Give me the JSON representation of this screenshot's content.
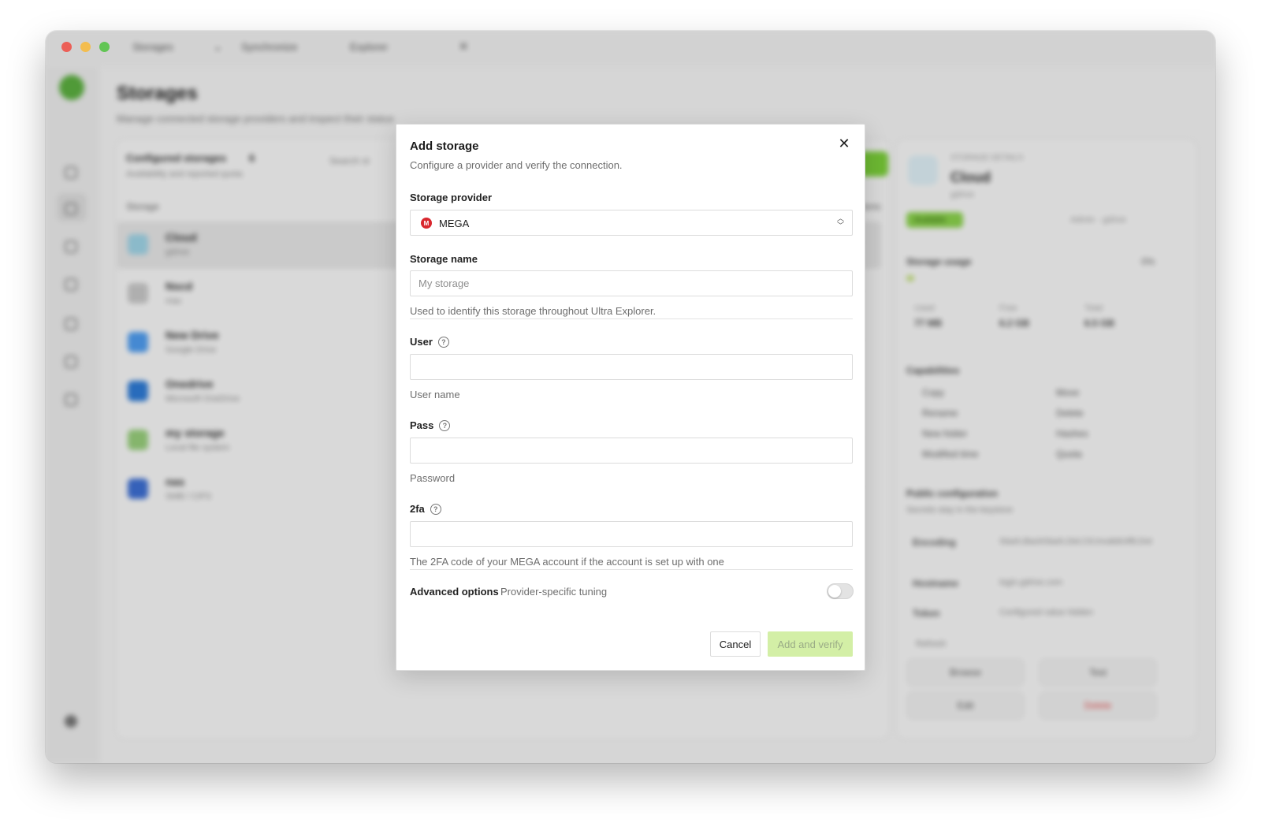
{
  "window": {
    "tabs": [
      "Storages",
      "Synchronize",
      "Explorer"
    ]
  },
  "page": {
    "title": "Storages",
    "subtitle": "Manage connected storage providers and inspect their status"
  },
  "storages_panel": {
    "title": "Configured storages",
    "count": "6",
    "subtitle": "Availability and reported quota",
    "search_placeholder": "Search st",
    "col_storage": "Storage",
    "col_actions": "Actions",
    "rows": [
      {
        "name": "Cloud",
        "type": "gdrive",
        "icon_color": "#9fd4e6"
      },
      {
        "name": "Nscd",
        "type": "mac",
        "icon_color": "#c8c8c8"
      },
      {
        "name": "New Drive",
        "type": "Google Drive",
        "icon_color": "#4f9df0"
      },
      {
        "name": "Onedrive",
        "type": "Microsoft OneDrive",
        "icon_color": "#2e7bd6"
      },
      {
        "name": "my storage",
        "type": "Local file system",
        "icon_color": "#98cf7c"
      },
      {
        "name": "nas",
        "type": "SMB / CIFS",
        "icon_color": "#3d6fd3"
      }
    ]
  },
  "details": {
    "label": "STORAGE DETAILS",
    "title": "Cloud",
    "subtitle": "gdrive",
    "status": "Available",
    "checked": "Admin · gdrive",
    "usage_title": "Storage usage",
    "usage_percent": "0%",
    "usage_fraction": 0.0,
    "stats": [
      {
        "label": "Used",
        "value": "77 MB"
      },
      {
        "label": "Free",
        "value": "6.2 GB"
      },
      {
        "label": "Total",
        "value": "6.5 GB"
      }
    ],
    "capabilities_title": "Capabilities",
    "capabilities": [
      "Copy",
      "Move",
      "Rename",
      "Delete",
      "New folder",
      "Hashes",
      "Modified time",
      "Quota"
    ],
    "public_title": "Public configuration",
    "public_sub": "Secrets stay in the keystore",
    "public_rows": [
      {
        "label": "Encoding",
        "value": "Slash,BackSlash,Del,Ctl,InvalidUtf8,Dot"
      },
      {
        "label": "Hostname",
        "value": "login.gdrive.com"
      },
      {
        "label": "Token",
        "value": "Configured value hidden"
      }
    ],
    "refresh": "Refresh",
    "actions": [
      "Browse",
      "Test",
      "Edit",
      "Delete"
    ]
  },
  "modal": {
    "title": "Add storage",
    "subtitle": "Configure a provider and verify the connection.",
    "provider_label": "Storage provider",
    "provider_value": "MEGA",
    "provider_icon": "mega-icon",
    "name_label": "Storage name",
    "name_placeholder": "My storage",
    "name_value": "",
    "name_hint": "Used to identify this storage throughout Ultra Explorer.",
    "user_label": "User",
    "user_value": "",
    "user_hint": "User name",
    "pass_label": "Pass",
    "pass_value": "",
    "pass_hint": "Password",
    "twofa_label": "2fa",
    "twofa_value": "",
    "twofa_hint": "The 2FA code of your MEGA account if the account is set up with one",
    "advanced_label": "Advanced options",
    "advanced_hint": "Provider-specific tuning",
    "advanced_enabled": false,
    "cancel": "Cancel",
    "submit": "Add and verify"
  },
  "colors": {
    "accent": "#7cd13a",
    "submit_disabled_bg": "#d3efa6",
    "mega_red": "#d9272e"
  }
}
